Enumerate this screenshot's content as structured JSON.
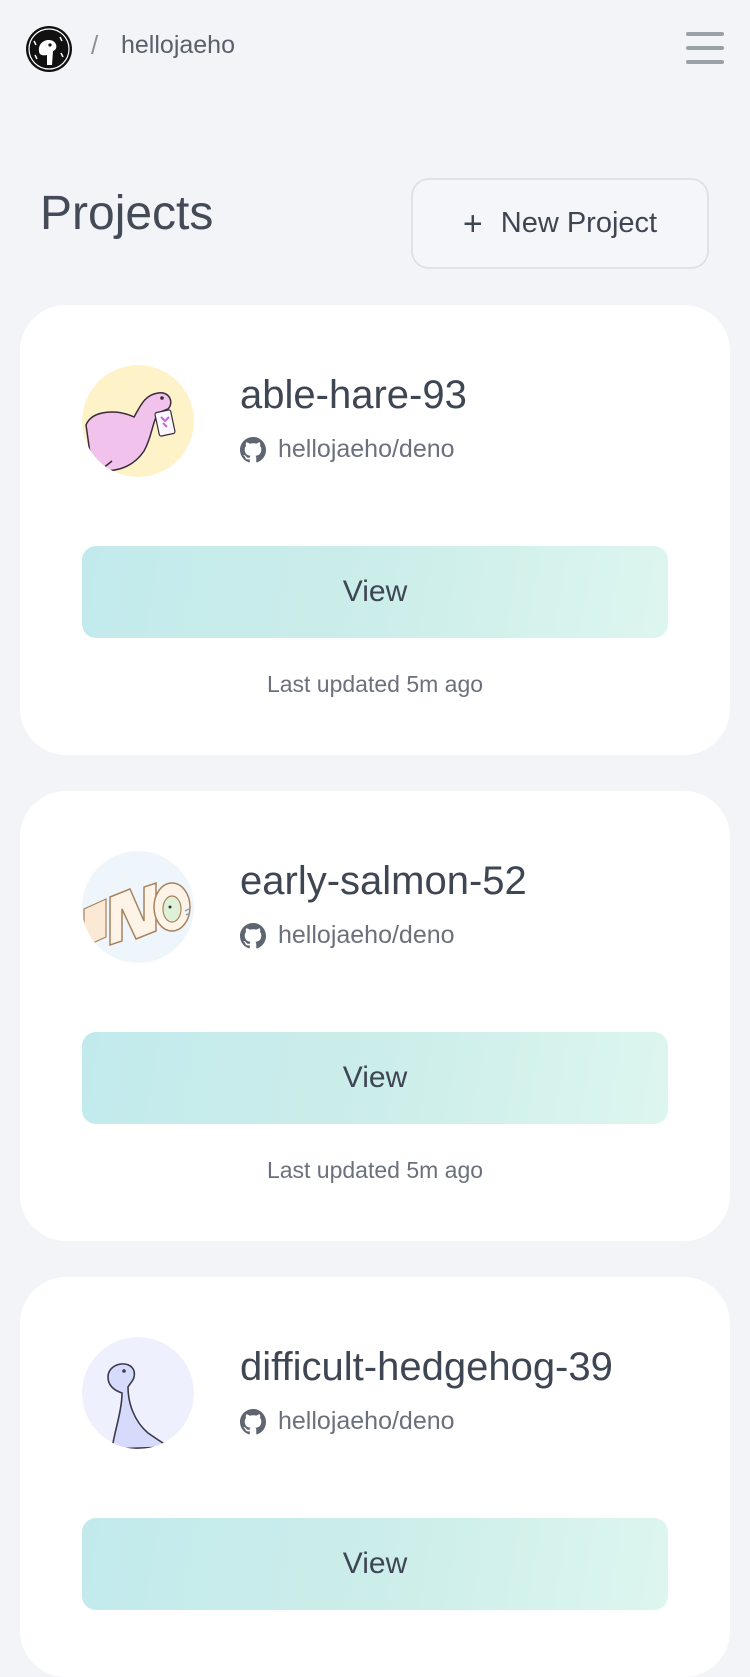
{
  "header": {
    "separator": "/",
    "user": "hellojaeho"
  },
  "page": {
    "title": "Projects",
    "new_project_label": "New Project"
  },
  "projects": [
    {
      "name": "able-hare-93",
      "repo": "hellojaeho/deno",
      "view_label": "View",
      "updated": "Last updated 5m ago"
    },
    {
      "name": "early-salmon-52",
      "repo": "hellojaeho/deno",
      "view_label": "View",
      "updated": "Last updated 5m ago"
    },
    {
      "name": "difficult-hedgehog-39",
      "repo": "hellojaeho/deno",
      "view_label": "View"
    }
  ],
  "icons": {
    "logo": "deno-logo-icon",
    "menu": "hamburger-menu-icon",
    "plus": "plus-icon",
    "repo": "github-icon"
  },
  "colors": {
    "background": "#f3f4f8",
    "card": "#ffffff",
    "view_button_start": "#c2eaec",
    "view_button_end": "#ddf6ef"
  }
}
